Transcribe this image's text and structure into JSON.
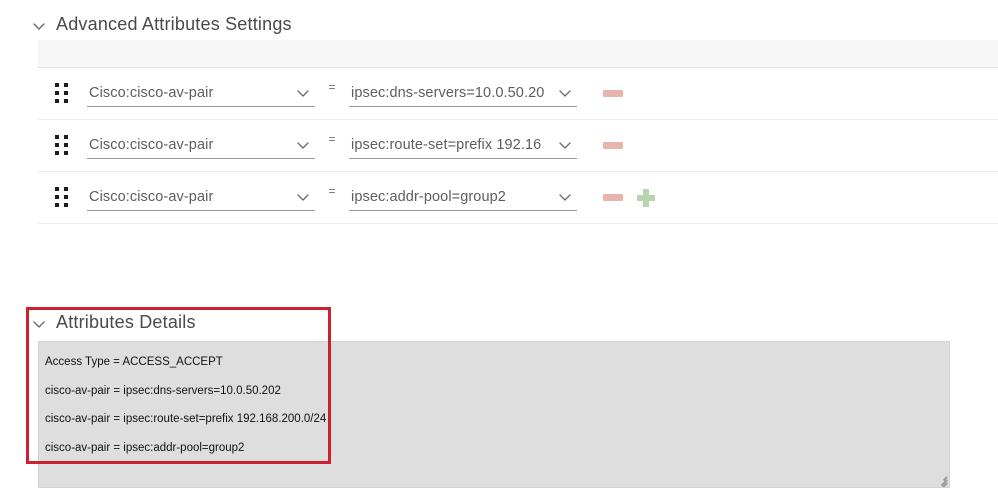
{
  "sections": {
    "advanced": {
      "title": "Advanced Attributes Settings",
      "collapse_icon": "chevron-down-icon"
    },
    "details": {
      "title": "Attributes Details",
      "collapse_icon": "chevron-down-icon"
    }
  },
  "attribute_rows": [
    {
      "drag_icon": "drag-handle-icon",
      "attribute": "Cisco:cisco-av-pair",
      "equals": "=",
      "value": "ipsec:dns-servers=10.0.50.20",
      "remove_icon": "minus-icon",
      "add_icon": null
    },
    {
      "drag_icon": "drag-handle-icon",
      "attribute": "Cisco:cisco-av-pair",
      "equals": "=",
      "value": "ipsec:route-set=prefix 192.16",
      "remove_icon": "minus-icon",
      "add_icon": null
    },
    {
      "drag_icon": "drag-handle-icon",
      "attribute": "Cisco:cisco-av-pair",
      "equals": "=",
      "value": "ipsec:addr-pool=group2",
      "remove_icon": "minus-icon",
      "add_icon": "plus-icon"
    }
  ],
  "details_text": [
    "Access Type = ACCESS_ACCEPT",
    "cisco-av-pair = ipsec:dns-servers=10.0.50.202",
    "cisco-av-pair = ipsec:route-set=prefix 192.168.200.0/24",
    "cisco-av-pair = ipsec:addr-pool=group2"
  ],
  "colors": {
    "annotation_red": "#cf2030",
    "remove_button": "#e8b4ad",
    "add_button": "#b7d3b0",
    "panel_background": "#dedede",
    "header_strip": "#f6f6f6"
  }
}
